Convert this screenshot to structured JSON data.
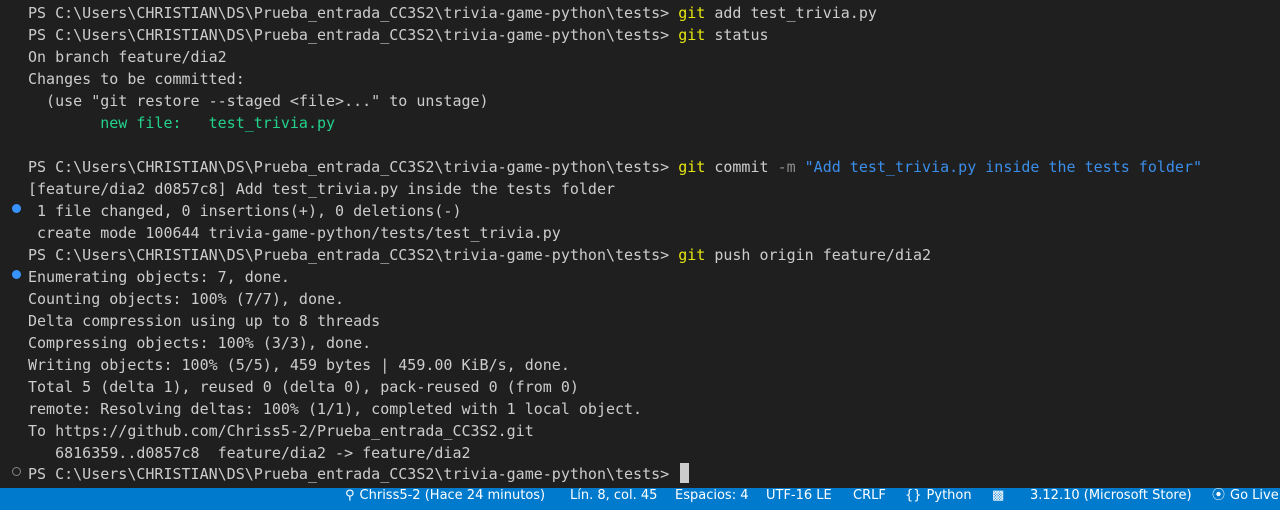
{
  "terminal": {
    "prompt": "PS C:\\Users\\CHRISTIAN\\DS\\Prueba_entrada_CC3S2\\trivia-game-python\\tests> ",
    "git": "git",
    "cmd1_args": " add test_trivia.py",
    "cmd2_args": " status",
    "status_branch": "On branch feature/dia2",
    "status_changes": "Changes to be committed:",
    "status_hint": "  (use \"git restore --staged <file>...\" to unstage)",
    "status_newfile": "        new file:   test_trivia.py",
    "cmd3_commit": " commit ",
    "cmd3_flag": "-m",
    "cmd3_message": " \"Add test_trivia.py inside the tests folder\"",
    "commit_summary": "[feature/dia2 d0857c8] Add test_trivia.py inside the tests folder",
    "commit_stats": " 1 file changed, 0 insertions(+), 0 deletions(-)",
    "commit_create": " create mode 100644 trivia-game-python/tests/test_trivia.py",
    "cmd4_args": " push origin feature/dia2",
    "push_lines": [
      "Enumerating objects: 7, done.",
      "Counting objects: 100% (7/7), done.",
      "Delta compression using up to 8 threads",
      "Compressing objects: 100% (3/3), done.",
      "Writing objects: 100% (5/5), 459 bytes | 459.00 KiB/s, done.",
      "Total 5 (delta 1), reused 0 (delta 0), pack-reused 0 (from 0)",
      "remote: Resolving deltas: 100% (1/1), completed with 1 local object.",
      "To https://github.com/Chriss5-2/Prueba_entrada_CC3S2.git",
      "   6816359..d0857c8  feature/dia2 -> feature/dia2"
    ]
  },
  "statusbar": {
    "blame": "Chriss5-2 (Hace 24 minutos)",
    "position": "Lín. 8, col. 45",
    "spaces": "Espacios: 4",
    "encoding": "UTF-16 LE",
    "eol": "CRLF",
    "language": "Python",
    "interpreter": "3.12.10 (Microsoft Store)",
    "golive": "Go Live"
  },
  "colors": {
    "background": "#1f1f1f",
    "git_yellow": "#e5e510",
    "string_blue": "#3b8eea",
    "added_green": "#23d18b",
    "statusbar_blue": "#007acc"
  }
}
